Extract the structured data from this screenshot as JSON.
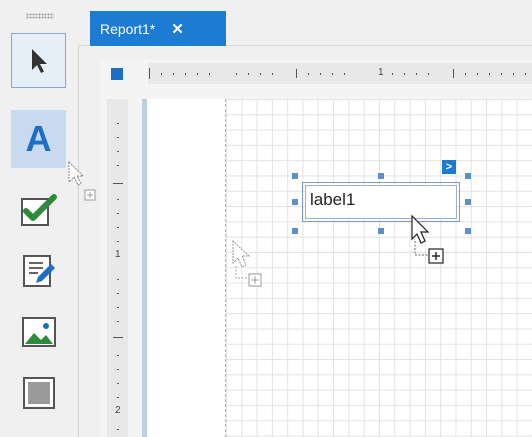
{
  "tab": {
    "title": "Report1*",
    "close": "✕"
  },
  "ruler": {
    "h_mark": "1",
    "v_marks": [
      "1",
      "2"
    ]
  },
  "label": {
    "text": "label1"
  },
  "smart_tag": {
    "glyph": ">"
  },
  "toolbox": {
    "items": [
      {
        "name": "pointer",
        "icon": "pointer-icon",
        "selected": true
      },
      {
        "name": "label",
        "icon": "label-A-icon",
        "glyph": "A"
      },
      {
        "name": "checkbox",
        "icon": "checkbox-icon"
      },
      {
        "name": "richtext",
        "icon": "edit-text-icon"
      },
      {
        "name": "picturebox",
        "icon": "picture-icon"
      },
      {
        "name": "panel",
        "icon": "panel-icon"
      }
    ]
  },
  "colors": {
    "accent": "#1c7bd2",
    "handle": "#5d8fc8",
    "grid": "#e3e3e3",
    "check": "#2e8b3a"
  }
}
